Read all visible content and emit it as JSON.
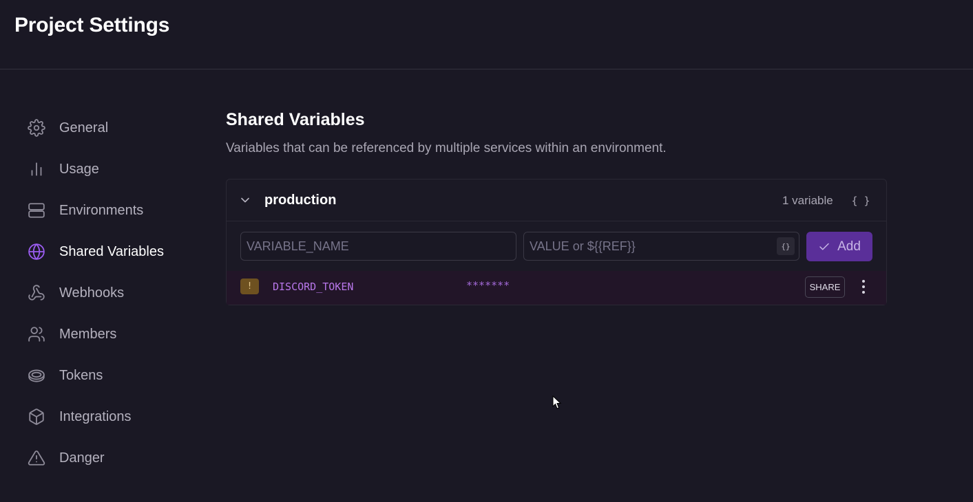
{
  "header": {
    "title": "Project Settings"
  },
  "sidebar": {
    "items": [
      {
        "label": "General",
        "icon": "gear-icon"
      },
      {
        "label": "Usage",
        "icon": "bar-chart-icon"
      },
      {
        "label": "Environments",
        "icon": "server-icon"
      },
      {
        "label": "Shared Variables",
        "icon": "globe-icon",
        "active": true
      },
      {
        "label": "Webhooks",
        "icon": "webhook-icon"
      },
      {
        "label": "Members",
        "icon": "users-icon"
      },
      {
        "label": "Tokens",
        "icon": "token-icon"
      },
      {
        "label": "Integrations",
        "icon": "box-icon"
      },
      {
        "label": "Danger",
        "icon": "warning-triangle-icon"
      }
    ]
  },
  "main": {
    "title": "Shared Variables",
    "description": "Variables that can be referenced by multiple services within an environment.",
    "environment": {
      "name": "production",
      "count_label": "1 variable",
      "raw_editor_label": "{ }",
      "new_variable": {
        "name_placeholder": "VARIABLE_NAME",
        "value_placeholder": "VALUE or ${{REF}}",
        "ref_button_label": "{}",
        "add_label": "Add"
      },
      "variables": [
        {
          "badge": "!",
          "name": "DISCORD_TOKEN",
          "value": "*******",
          "share_label": "SHARE"
        }
      ]
    }
  },
  "colors": {
    "background": "#1a1824",
    "accent": "#9a5cf0",
    "add_button": "#5a2f99",
    "variable_row": "#221528",
    "warning_badge": "#6e5120"
  }
}
